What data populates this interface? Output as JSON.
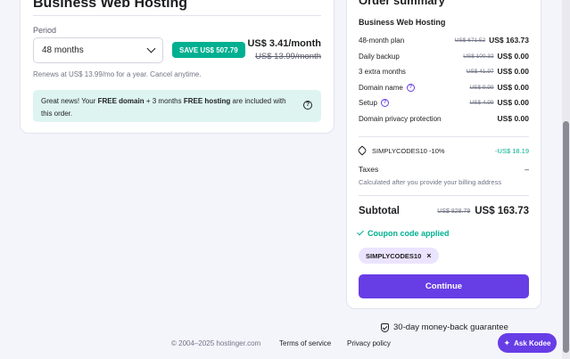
{
  "hosting": {
    "title": "Business Web Hosting",
    "period_label": "Period",
    "period_value": "48 months",
    "save_badge": "SAVE US$ 507.79",
    "price_month": "US$ 3.41/month",
    "price_old": "US$ 13.99/month",
    "renew_note": "Renews at US$ 13.99/mo for a year. Cancel anytime.",
    "info": {
      "part1": "Great news! Your ",
      "free_domain": "FREE domain",
      "part2": " + 3 months ",
      "free_hosting": "FREE hosting",
      "part3": " are included with this order."
    }
  },
  "summary": {
    "title": "Order summary",
    "product": "Business Web Hosting",
    "lines": [
      {
        "name": "48-month plan",
        "old": "US$ 671.52",
        "new": "US$ 163.73"
      },
      {
        "name": "Daily backup",
        "old": "US$ 100.32",
        "new": "US$ 0.00"
      },
      {
        "name": "3 extra months",
        "old": "US$ 41.97",
        "new": "US$ 0.00"
      },
      {
        "name": "Domain name",
        "old": "US$ 9.99",
        "new": "US$ 0.00"
      },
      {
        "name": "Setup",
        "old": "US$ 4.99",
        "new": "US$ 0.00"
      },
      {
        "name": "Domain privacy protection",
        "old": "",
        "new": "US$ 0.00"
      }
    ],
    "coupon_line": "SIMPLYCODES10 -10%",
    "coupon_discount": "-US$ 18.19",
    "taxes_label": "Taxes",
    "taxes_value": "–",
    "taxes_note": "Calculated after you provide your billing address",
    "subtotal_label": "Subtotal",
    "subtotal_old": "US$ 828.79",
    "subtotal_new": "US$ 163.73",
    "coupon_applied": "Coupon code applied",
    "coupon_chip": "SIMPLYCODES10",
    "continue_label": "Continue"
  },
  "guarantee": "30-day money-back guarantee",
  "footer": {
    "copyright": "© 2004–2025 hostinger.com",
    "terms": "Terms of service",
    "privacy": "Privacy policy"
  },
  "ask_kodee": "Ask Kodee",
  "colors": {
    "accent": "#673de6",
    "success": "#00b090",
    "info_bg": "#def4f0"
  }
}
